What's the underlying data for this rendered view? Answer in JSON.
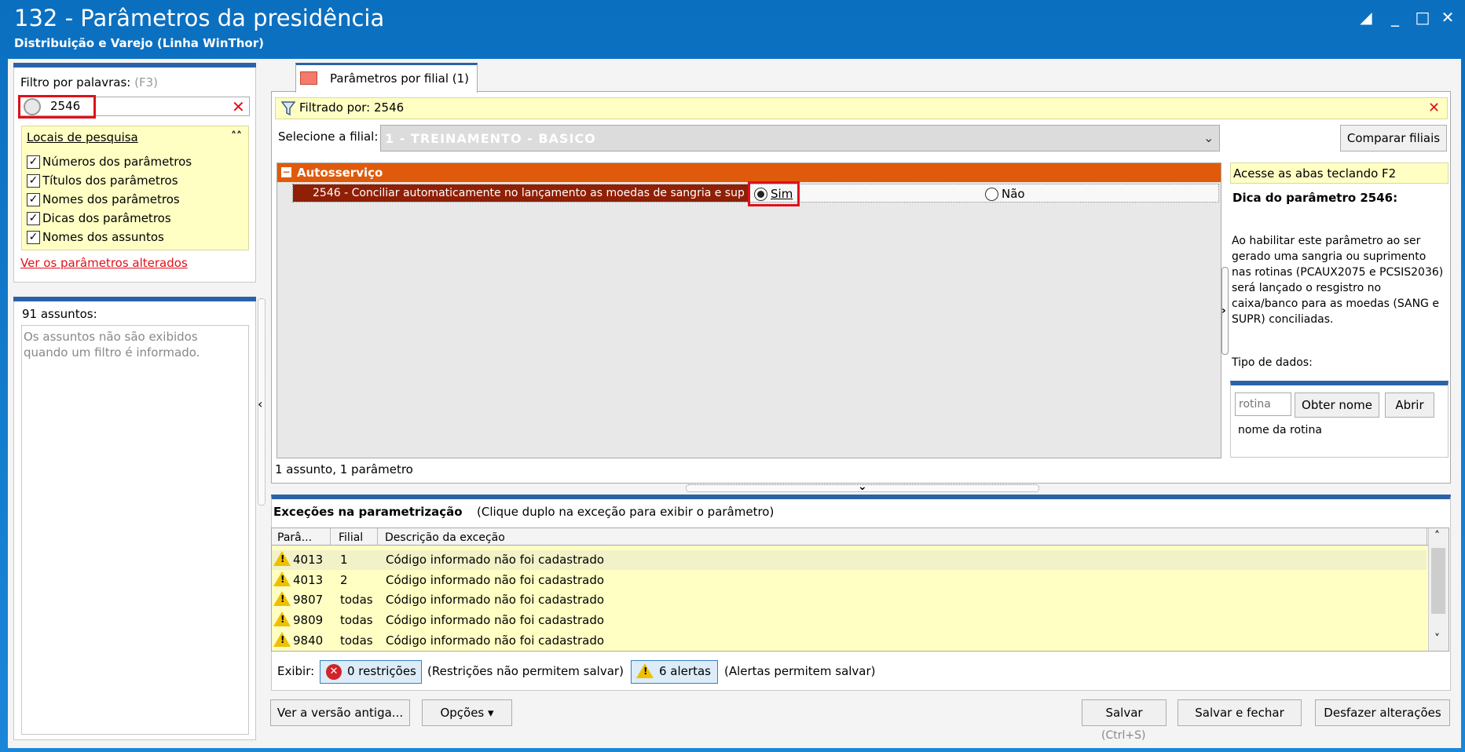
{
  "window": {
    "title": "132 - Parâmetros da presidência",
    "subtitle": "Distribuição e Varejo (Linha WinThor)"
  },
  "sidebar": {
    "filter_label": "Filtro por palavras:",
    "filter_shortcut": "(F3)",
    "search_value": "2546",
    "locais_title": "Locais de pesquisa",
    "options": [
      {
        "label": "Números dos parâmetros",
        "checked": true
      },
      {
        "label": "Títulos dos parâmetros",
        "checked": true
      },
      {
        "label": "Nomes dos parâmetros",
        "checked": true
      },
      {
        "label": "Dicas dos parâmetros",
        "checked": true
      },
      {
        "label": "Nomes dos assuntos",
        "checked": true
      }
    ],
    "changed_link": "Ver os parâmetros alterados",
    "assuntos_count": "91 assuntos:",
    "assuntos_empty": "Os assuntos não são exibidos quando um filtro é informado."
  },
  "main": {
    "tab_label": "Parâmetros por filial  (1)",
    "filtered_by": "Filtrado por: 2546",
    "filial_label": "Selecione a filial:",
    "filial_value": "1 - TREINAMENTO - BASICO",
    "compare_button": "Comparar filiais",
    "group_title": "Autosserviço",
    "param_label": "2546 - Conciliar automaticamente no lançamento as moedas de sangria e sup",
    "option_yes": "Sim",
    "option_no": "Não",
    "selected_option": "Sim",
    "summary": "1 assunto, 1 parâmetro"
  },
  "hint": {
    "bar_text": "Acesse as abas teclando F2",
    "title": "Dica do parâmetro 2546:",
    "body": "Ao habilitar este parâmetro ao ser gerado uma sangria ou suprimento nas rotinas  (PCAUX2075 e PCSIS2036) será lançado o resgistro no caixa/banco para as moedas (SANG e SUPR) conciliadas.",
    "type_label": "Tipo de dados:",
    "rotina_placeholder": "rotina",
    "obter_button": "Obter nome",
    "abrir_button": "Abrir",
    "rotina_name": "nome da rotina"
  },
  "exceptions": {
    "title": "Exceções na parametrização",
    "subtitle": "(Clique duplo na exceção para exibir o parâmetro)",
    "columns": [
      "Parâ...",
      "Filial",
      "Descrição da exceção"
    ],
    "rows": [
      {
        "param": "4013",
        "filial": "1",
        "desc": "Código informado não foi cadastrado"
      },
      {
        "param": "4013",
        "filial": "2",
        "desc": "Código informado não foi cadastrado"
      },
      {
        "param": "9807",
        "filial": "todas",
        "desc": "Código informado não foi cadastrado"
      },
      {
        "param": "9809",
        "filial": "todas",
        "desc": "Código informado não foi cadastrado"
      },
      {
        "param": "9840",
        "filial": "todas",
        "desc": "Código informado não foi cadastrado"
      }
    ],
    "exibir_label": "Exibir:",
    "restricoes_button": "0 restrições",
    "restricoes_note": "(Restrições não permitem salvar)",
    "alertas_button": "6 alertas",
    "alertas_note": "(Alertas permitem salvar)"
  },
  "footer": {
    "old_version_button": "Ver a versão antiga...",
    "options_button": "Opções",
    "save_button": "Salvar",
    "save_shortcut": "(Ctrl+S)",
    "save_close_button": "Salvar e fechar",
    "undo_button": "Desfazer alterações"
  },
  "colors": {
    "accent": "#2a62a8",
    "group_header": "#e05a0c",
    "param_label_bg": "#8f1f05",
    "highlight": "#e0101a",
    "info_bg": "#ffffc4"
  }
}
